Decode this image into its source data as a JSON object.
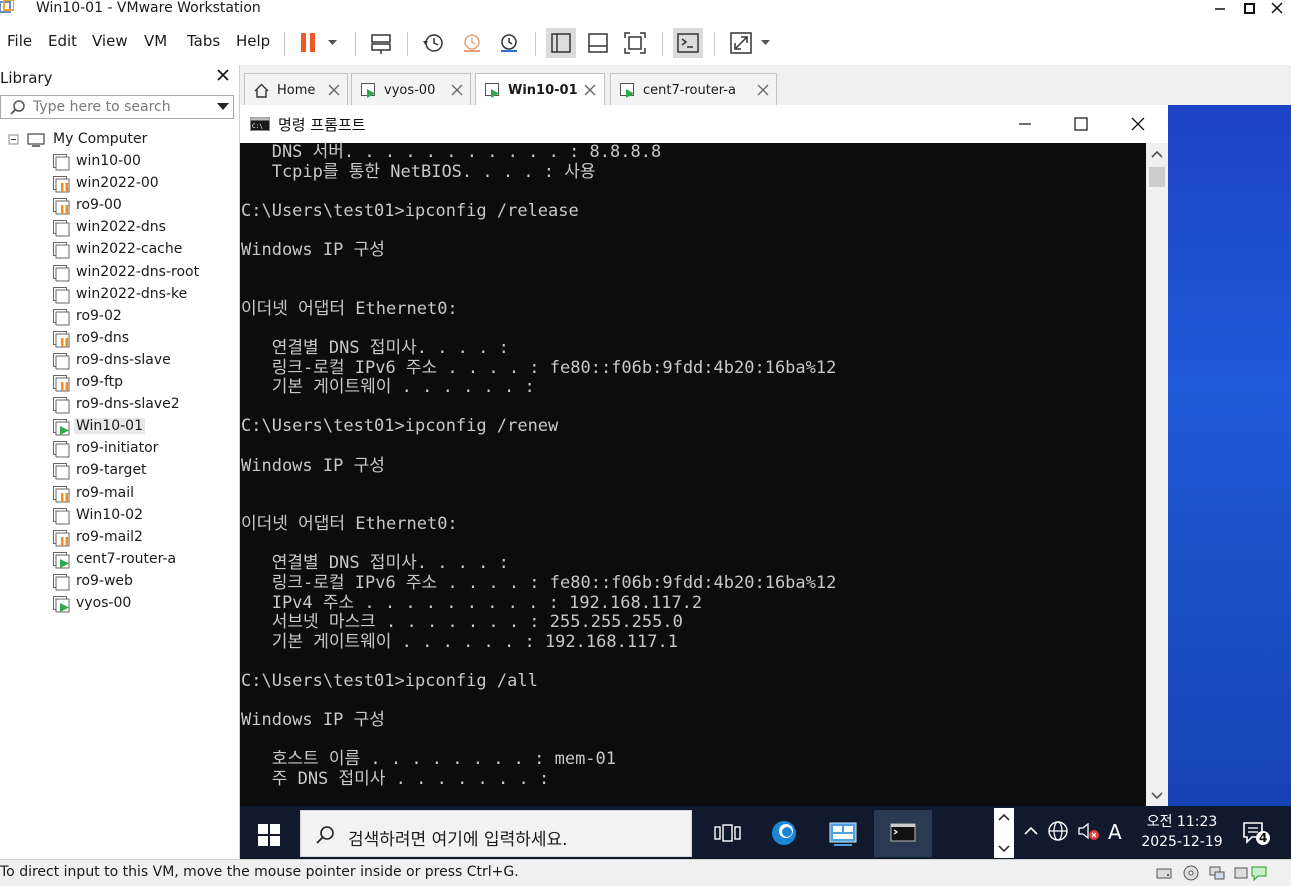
{
  "window": {
    "title": "Win10-01 - VMware Workstation"
  },
  "menu": {
    "file": "File",
    "edit": "Edit",
    "view": "View",
    "vm": "VM",
    "tabs": "Tabs",
    "help": "Help"
  },
  "library": {
    "header": "Library",
    "search_placeholder": "Type here to search",
    "root": "My Computer",
    "items": [
      {
        "label": "win10-00",
        "state": "off"
      },
      {
        "label": "win2022-00",
        "state": "suspended"
      },
      {
        "label": "ro9-00",
        "state": "suspended"
      },
      {
        "label": "win2022-dns",
        "state": "off"
      },
      {
        "label": "win2022-cache",
        "state": "off"
      },
      {
        "label": "win2022-dns-root",
        "state": "off"
      },
      {
        "label": "win2022-dns-ke",
        "state": "off"
      },
      {
        "label": "ro9-02",
        "state": "off"
      },
      {
        "label": "ro9-dns",
        "state": "suspended"
      },
      {
        "label": "ro9-dns-slave",
        "state": "off"
      },
      {
        "label": "ro9-ftp",
        "state": "suspended"
      },
      {
        "label": "ro9-dns-slave2",
        "state": "off"
      },
      {
        "label": "Win10-01",
        "state": "running"
      },
      {
        "label": "ro9-initiator",
        "state": "off"
      },
      {
        "label": "ro9-target",
        "state": "off"
      },
      {
        "label": "ro9-mail",
        "state": "suspended"
      },
      {
        "label": "Win10-02",
        "state": "off"
      },
      {
        "label": "ro9-mail2",
        "state": "suspended"
      },
      {
        "label": "cent7-router-a",
        "state": "running"
      },
      {
        "label": "ro9-web",
        "state": "off"
      },
      {
        "label": "vyos-00",
        "state": "running"
      }
    ]
  },
  "tabs": [
    {
      "label": "Home",
      "icon": "home-icon"
    },
    {
      "label": "vyos-00",
      "icon": "vm-running-icon"
    },
    {
      "label": "Win10-01",
      "icon": "vm-running-icon",
      "active": true
    },
    {
      "label": "cent7-router-a",
      "icon": "vm-running-icon"
    }
  ],
  "cmd": {
    "title": "명령 프롬프트",
    "lines": [
      "   DNS 서버. . . . . . . . . . . : 8.8.8.8",
      "   Tcpip를 통한 NetBIOS. . . . : 사용",
      "",
      "C:\\Users\\test01>ipconfig /release",
      "",
      "Windows IP 구성",
      "",
      "",
      "이더넷 어댑터 Ethernet0:",
      "",
      "   연결별 DNS 접미사. . . . :",
      "   링크-로컬 IPv6 주소 . . . . : fe80::f06b:9fdd:4b20:16ba%12",
      "   기본 게이트웨이 . . . . . . :",
      "",
      "C:\\Users\\test01>ipconfig /renew",
      "",
      "Windows IP 구성",
      "",
      "",
      "이더넷 어댑터 Ethernet0:",
      "",
      "   연결별 DNS 접미사. . . . :",
      "   링크-로컬 IPv6 주소 . . . . : fe80::f06b:9fdd:4b20:16ba%12",
      "   IPv4 주소 . . . . . . . . . : 192.168.117.2",
      "   서브넷 마스크 . . . . . . . : 255.255.255.0",
      "   기본 게이트웨이 . . . . . . : 192.168.117.1",
      "",
      "C:\\Users\\test01>ipconfig /all",
      "",
      "Windows IP 구성",
      "",
      "   호스트 이름 . . . . . . . . : mem-01",
      "   주 DNS 접미사 . . . . . . . :"
    ]
  },
  "taskbar": {
    "search_placeholder": "검색하려면 여기에 입력하세요.",
    "ime": "A",
    "time_period": "오전",
    "time": "11:23",
    "date": "2025-12-19",
    "notification_count": "4"
  },
  "statusbar": {
    "text": "To direct input to this VM, move the mouse pointer inside or press Ctrl+G."
  },
  "colors": {
    "pause_accent": "#f05a22",
    "console_bg": "#0c0c0c",
    "console_fg": "#c8c8c8",
    "desktop_blue": "#1e4bb8",
    "taskbar_bg": "#101a2c",
    "vm_running": "#2fa84f",
    "vm_suspended": "#f28c28"
  }
}
